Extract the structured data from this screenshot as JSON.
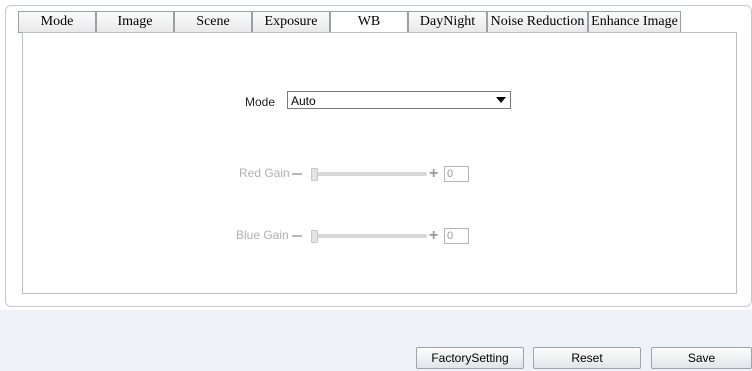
{
  "tabs": [
    {
      "label": "Mode"
    },
    {
      "label": "Image"
    },
    {
      "label": "Scene"
    },
    {
      "label": "Exposure"
    },
    {
      "label": "WB"
    },
    {
      "label": "DayNight"
    },
    {
      "label": "Noise Reduction"
    },
    {
      "label": "Enhance Image"
    }
  ],
  "active_tab": "WB",
  "wb": {
    "mode_label": "Mode",
    "mode_value": "Auto",
    "red_gain": {
      "label": "Red Gain",
      "value": "0",
      "level": 0,
      "disabled": true
    },
    "blue_gain": {
      "label": "Blue Gain",
      "value": "0",
      "level": 0,
      "disabled": true
    }
  },
  "buttons": {
    "factory": "FactorySetting",
    "reset": "Reset",
    "save": "Save"
  },
  "icons": {
    "dropdown": "chevron-down-icon",
    "minus": "minus-icon",
    "plus": "plus-icon"
  },
  "colors": {
    "page_bg": "#eef1f6",
    "disabled_text": "#b0b0b0",
    "border": "#9aa0a8"
  }
}
